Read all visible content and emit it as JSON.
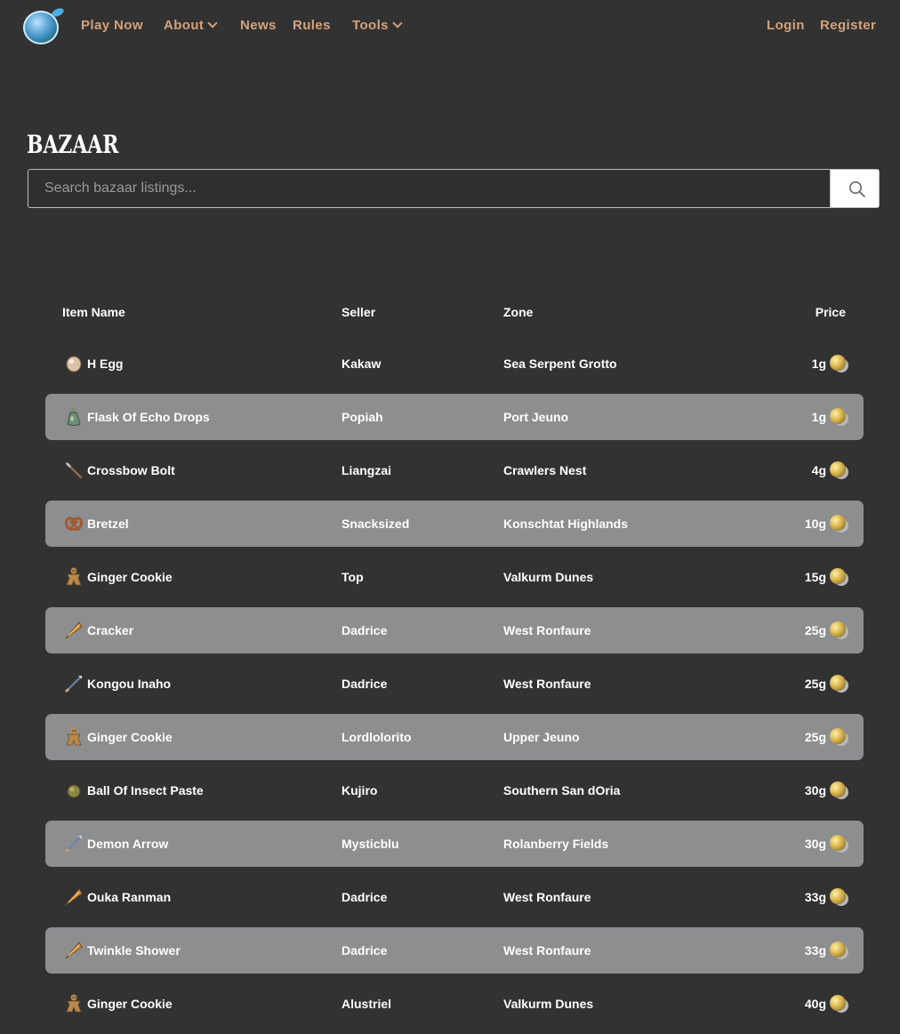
{
  "nav": {
    "links": [
      {
        "label": "Play Now"
      },
      {
        "label": "About"
      },
      {
        "label": "News"
      },
      {
        "label": "Rules"
      },
      {
        "label": "Tools"
      }
    ],
    "login": "Login",
    "register": "Register"
  },
  "page": {
    "title": "BAZAAR"
  },
  "search": {
    "placeholder": "Search bazaar listings..."
  },
  "table": {
    "headers": {
      "item": "Item Name",
      "seller": "Seller",
      "zone": "Zone",
      "price": "Price"
    },
    "rows": [
      {
        "item": "H Egg",
        "seller": "Kakaw",
        "zone": "Sea Serpent Grotto",
        "price": "1g",
        "icon": "egg-icon"
      },
      {
        "item": "Flask Of Echo Drops",
        "seller": "Popiah",
        "zone": "Port Jeuno",
        "price": "1g",
        "icon": "flask-icon"
      },
      {
        "item": "Crossbow Bolt",
        "seller": "Liangzai",
        "zone": "Crawlers Nest",
        "price": "4g",
        "icon": "bolt-icon"
      },
      {
        "item": "Bretzel",
        "seller": "Snacksized",
        "zone": "Konschtat Highlands",
        "price": "10g",
        "icon": "pretzel-icon"
      },
      {
        "item": "Ginger Cookie",
        "seller": "Top",
        "zone": "Valkurm Dunes",
        "price": "15g",
        "icon": "cookie-icon"
      },
      {
        "item": "Cracker",
        "seller": "Dadrice",
        "zone": "West Ronfaure",
        "price": "25g",
        "icon": "cracker-icon"
      },
      {
        "item": "Kongou Inaho",
        "seller": "Dadrice",
        "zone": "West Ronfaure",
        "price": "25g",
        "icon": "arrow-icon"
      },
      {
        "item": "Ginger Cookie",
        "seller": "Lordlolorito",
        "zone": "Upper Jeuno",
        "price": "25g",
        "icon": "cookie-icon"
      },
      {
        "item": "Ball Of Insect Paste",
        "seller": "Kujiro",
        "zone": "Southern San dOria",
        "price": "30g",
        "icon": "paste-icon"
      },
      {
        "item": "Demon Arrow",
        "seller": "Mysticblu",
        "zone": "Rolanberry Fields",
        "price": "30g",
        "icon": "arrow-icon"
      },
      {
        "item": "Ouka Ranman",
        "seller": "Dadrice",
        "zone": "West Ronfaure",
        "price": "33g",
        "icon": "cracker-icon"
      },
      {
        "item": "Twinkle Shower",
        "seller": "Dadrice",
        "zone": "West Ronfaure",
        "price": "33g",
        "icon": "cracker-icon"
      },
      {
        "item": "Ginger Cookie",
        "seller": "Alustriel",
        "zone": "Valkurm Dunes",
        "price": "40g",
        "icon": "cookie-icon"
      }
    ]
  },
  "colors": {
    "background": "#323232",
    "nav_link": "#d4a27c",
    "row_alt": "#8d8e90"
  }
}
